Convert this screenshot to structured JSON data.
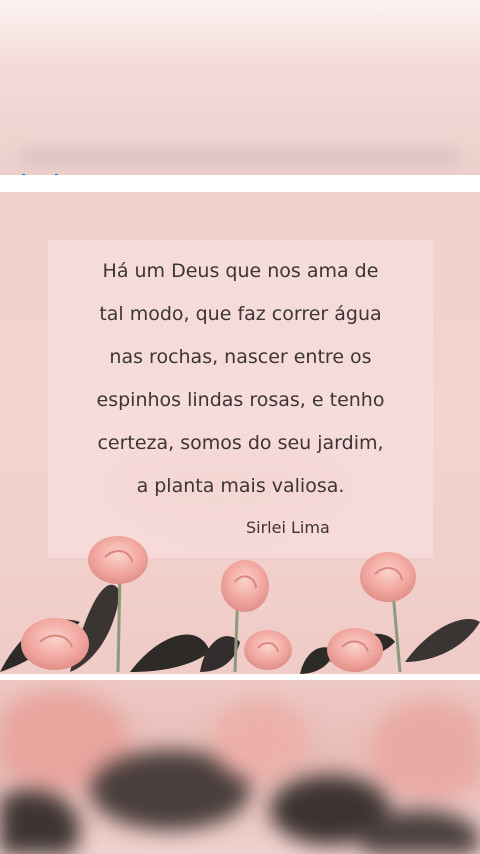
{
  "quote": {
    "lines": [
      "Há um Deus que nos ama de",
      "tal modo, que faz correr água",
      "nas rochas, nascer entre os",
      "espinhos lindas rosas, e tenho",
      "certeza, somos do seu jardim,",
      "a planta mais valiosa."
    ],
    "author": "Sirlei Lima"
  },
  "colors": {
    "background_pink": "#f1d1cd",
    "rose_pink": "#f2a9a2",
    "leaf_dark": "#2d2a28",
    "text": "#3c3435"
  }
}
